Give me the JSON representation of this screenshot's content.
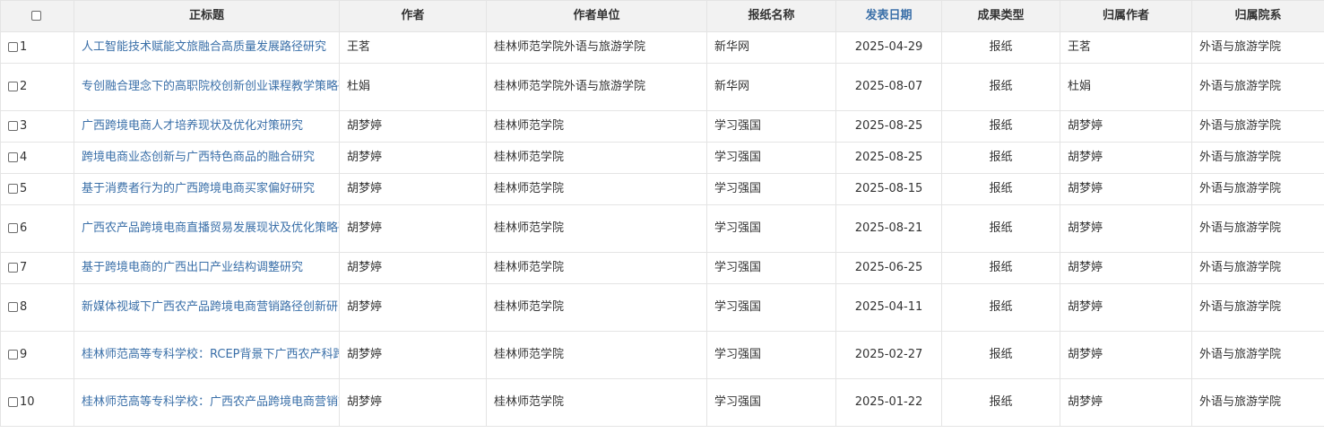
{
  "headers": {
    "title": "正标题",
    "author": "作者",
    "unit": "作者单位",
    "newspaper": "报纸名称",
    "date": "发表日期",
    "type": "成果类型",
    "owner": "归属作者",
    "dept": "归属院系"
  },
  "colors": {
    "link": "#3a6fa8",
    "header_bg": "#f2f2f2",
    "border": "#e4e4e4"
  },
  "rows": [
    {
      "num": "1",
      "title": "人工智能技术赋能文旅融合高质量发展路径研究",
      "author": "王茗",
      "unit": "桂林师范学院外语与旅游学院",
      "newspaper": "新华网",
      "date": "2025-04-29",
      "type": "报纸",
      "owner": "王茗",
      "dept": "外语与旅游学院"
    },
    {
      "num": "2",
      "title": "专创融合理念下的高职院校创新创业课程教学策略研究",
      "author": "杜娟",
      "unit": "桂林师范学院外语与旅游学院",
      "newspaper": "新华网",
      "date": "2025-08-07",
      "type": "报纸",
      "owner": "杜娟",
      "dept": "外语与旅游学院"
    },
    {
      "num": "3",
      "title": "广西跨境电商人才培养现状及优化对策研究",
      "author": "胡梦婷",
      "unit": "桂林师范学院",
      "newspaper": "学习强国",
      "date": "2025-08-25",
      "type": "报纸",
      "owner": "胡梦婷",
      "dept": "外语与旅游学院"
    },
    {
      "num": "4",
      "title": "跨境电商业态创新与广西特色商品的融合研究",
      "author": "胡梦婷",
      "unit": "桂林师范学院",
      "newspaper": "学习强国",
      "date": "2025-08-25",
      "type": "报纸",
      "owner": "胡梦婷",
      "dept": "外语与旅游学院"
    },
    {
      "num": "5",
      "title": "基于消费者行为的广西跨境电商买家偏好研究",
      "author": "胡梦婷",
      "unit": "桂林师范学院",
      "newspaper": "学习强国",
      "date": "2025-08-15",
      "type": "报纸",
      "owner": "胡梦婷",
      "dept": "外语与旅游学院"
    },
    {
      "num": "6",
      "title": "广西农产品跨境电商直播贸易发展现状及优化策略研究",
      "author": "胡梦婷",
      "unit": "桂林师范学院",
      "newspaper": "学习强国",
      "date": "2025-08-21",
      "type": "报纸",
      "owner": "胡梦婷",
      "dept": "外语与旅游学院"
    },
    {
      "num": "7",
      "title": "基于跨境电商的广西出口产业结构调整研究",
      "author": "胡梦婷",
      "unit": "桂林师范学院",
      "newspaper": "学习强国",
      "date": "2025-06-25",
      "type": "报纸",
      "owner": "胡梦婷",
      "dept": "外语与旅游学院"
    },
    {
      "num": "8",
      "title": "新媒体视域下广西农产品跨境电商营销路径创新研究",
      "author": "胡梦婷",
      "unit": "桂林师范学院",
      "newspaper": "学习强国",
      "date": "2025-04-11",
      "type": "报纸",
      "owner": "胡梦婷",
      "dept": "外语与旅游学院"
    },
    {
      "num": "9",
      "title": "桂林师范高等专科学校：RCEP背景下广西农产科跨境电商发展策略",
      "author": "胡梦婷",
      "unit": "桂林师范学院",
      "newspaper": "学习强国",
      "date": "2025-02-27",
      "type": "报纸",
      "owner": "胡梦婷",
      "dept": "外语与旅游学院"
    },
    {
      "num": "10",
      "title": "桂林师范高等专科学校：广西农产品跨境电商营销策略研究",
      "author": "胡梦婷",
      "unit": "桂林师范学院",
      "newspaper": "学习强国",
      "date": "2025-01-22",
      "type": "报纸",
      "owner": "胡梦婷",
      "dept": "外语与旅游学院"
    }
  ]
}
